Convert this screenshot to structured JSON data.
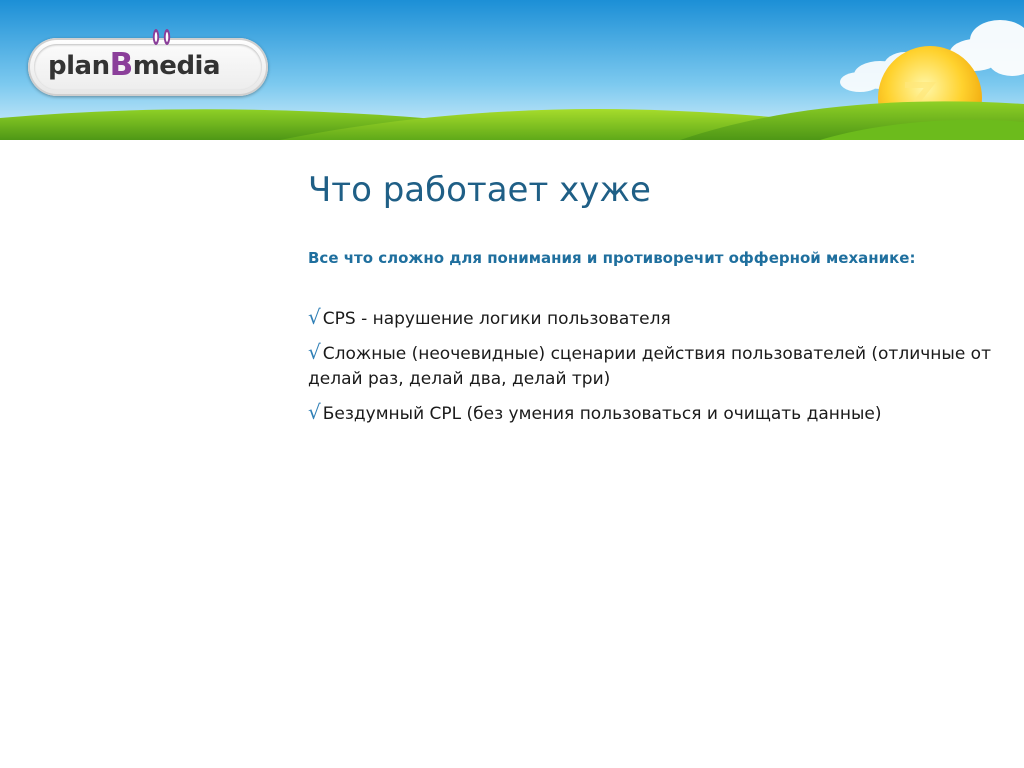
{
  "header": {
    "logo": {
      "prefix": "plan",
      "accent": "B",
      "suffix": "media"
    }
  },
  "slide": {
    "title": "Что работает хуже",
    "subtitle": "Все что сложно для понимания и противоречит офферной механике:",
    "bullets": [
      {
        "icon": "checkmark-icon",
        "text": "CPS - нарушение логики пользователя"
      },
      {
        "icon": "checkmark-icon",
        "text": "Сложные (неочевидные) сценарии действия пользователей (отличные от делай раз, делай два, делай три)"
      },
      {
        "icon": "checkmark-icon",
        "text": "Бездумный CPL (без умения пользоваться и очищать данные)"
      }
    ],
    "bullet_glyph": "√"
  },
  "colors": {
    "title": "#1f5f86",
    "subtitle": "#1f6f9e",
    "check": "#2f7fb6",
    "sky_top": "#2fa0dc",
    "sky_bottom": "#bfe6f7",
    "hills": "#7cc51e",
    "logo_accent": "#8b3f9a"
  }
}
